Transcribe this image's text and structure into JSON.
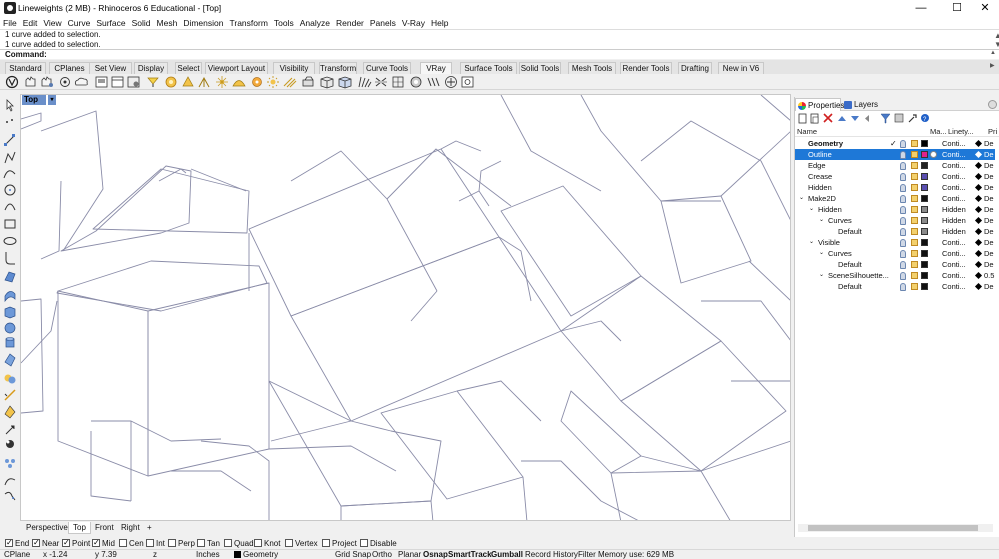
{
  "window": {
    "title": "Lineweights (2 MB) - Rhinoceros 6 Educational - [Top]",
    "minimize": "—",
    "maximize": "☐",
    "close": "✕"
  },
  "menu": [
    "File",
    "Edit",
    "View",
    "Curve",
    "Surface",
    "Solid",
    "Mesh",
    "Dimension",
    "Transform",
    "Tools",
    "Analyze",
    "Render",
    "Panels",
    "V-Ray",
    "Help"
  ],
  "command_history": [
    "1 curve added to selection.",
    "1 curve added to selection."
  ],
  "command": {
    "label": "Command:",
    "value": ""
  },
  "toolbar_tabs": [
    {
      "label": "Standard",
      "active": false
    },
    {
      "label": "CPlanes",
      "active": false
    },
    {
      "label": "Set View",
      "active": false
    },
    {
      "label": "Display",
      "active": false
    },
    {
      "label": "Select",
      "active": false
    },
    {
      "label": "Viewport Layout",
      "active": false
    },
    {
      "label": "Visibility",
      "active": false
    },
    {
      "label": "Transform",
      "active": false
    },
    {
      "label": "Curve Tools",
      "active": false
    },
    {
      "label": "VRay All",
      "active": true
    },
    {
      "label": "Surface Tools",
      "active": false
    },
    {
      "label": "Solid Tools",
      "active": false
    },
    {
      "label": "Mesh Tools",
      "active": false
    },
    {
      "label": "Render Tools",
      "active": false
    },
    {
      "label": "Drafting",
      "active": false
    },
    {
      "label": "New in V6",
      "active": false
    }
  ],
  "viewport": {
    "name": "Top",
    "caret": "▾"
  },
  "view_tabs": [
    {
      "label": "Perspective",
      "active": false
    },
    {
      "label": "Top",
      "active": true
    },
    {
      "label": "Front",
      "active": false
    },
    {
      "label": "Right",
      "active": false
    },
    {
      "label": "+",
      "active": false
    }
  ],
  "osnaps": [
    {
      "label": "End",
      "checked": true
    },
    {
      "label": "Near",
      "checked": true
    },
    {
      "label": "Point",
      "checked": true
    },
    {
      "label": "Mid",
      "checked": true
    },
    {
      "label": "Cen",
      "checked": false
    },
    {
      "label": "Int",
      "checked": false
    },
    {
      "label": "Perp",
      "checked": false
    },
    {
      "label": "Tan",
      "checked": false
    },
    {
      "label": "Quad",
      "checked": false
    },
    {
      "label": "Knot",
      "checked": false
    },
    {
      "label": "Vertex",
      "checked": false
    },
    {
      "label": "Project",
      "checked": false
    },
    {
      "label": "Disable",
      "checked": false
    }
  ],
  "status": {
    "cplane": "CPlane",
    "x": "x -1.24",
    "y": "y 7.39",
    "z": "z",
    "units": "Inches",
    "layer": "Geometry",
    "layer_color": "#000000",
    "toggles": [
      {
        "label": "Grid Snap",
        "bold": false
      },
      {
        "label": "Ortho",
        "bold": false
      },
      {
        "label": "Planar",
        "bold": false
      },
      {
        "label": "Osnap",
        "bold": true
      },
      {
        "label": "SmartTrack",
        "bold": true
      },
      {
        "label": "Gumball",
        "bold": true
      },
      {
        "label": "Record History",
        "bold": false
      },
      {
        "label": "Filter",
        "bold": false
      }
    ],
    "memory": "Memory use: 629 MB"
  },
  "panel": {
    "tabs": [
      {
        "label": "Properties",
        "active": true,
        "icon": "properties-icon"
      },
      {
        "label": "Layers",
        "active": false,
        "icon": "layers-icon"
      }
    ],
    "columns": {
      "name": "Name",
      "material": "Ma...",
      "linetype": "Linety...",
      "print": "Pri"
    },
    "layers": [
      {
        "name": "Geometry",
        "depth": 0,
        "expander": "",
        "bold": true,
        "current": true,
        "color": "#000000",
        "linetype": "Conti...",
        "print": "De",
        "selected": false
      },
      {
        "name": "Outline",
        "depth": 0,
        "expander": "",
        "bold": false,
        "current": false,
        "color": "#e0208a",
        "linetype": "Conti...",
        "print": "De",
        "selected": true
      },
      {
        "name": "Edge",
        "depth": 0,
        "expander": "",
        "bold": false,
        "current": false,
        "color": "#222222",
        "linetype": "Conti...",
        "print": "De",
        "selected": false
      },
      {
        "name": "Crease",
        "depth": 0,
        "expander": "",
        "bold": false,
        "current": false,
        "color": "#5a4fb0",
        "linetype": "Conti...",
        "print": "De",
        "selected": false
      },
      {
        "name": "Hidden",
        "depth": 0,
        "expander": "",
        "bold": false,
        "current": false,
        "color": "#5a4fb0",
        "linetype": "Conti...",
        "print": "De",
        "selected": false
      },
      {
        "name": "Make2D",
        "depth": 0,
        "expander": "⌄",
        "bold": false,
        "current": false,
        "color": "#111111",
        "linetype": "Conti...",
        "print": "De",
        "selected": false
      },
      {
        "name": "Hidden",
        "depth": 1,
        "expander": "⌄",
        "bold": false,
        "current": false,
        "color": "#8a8a8a",
        "linetype": "Hidden",
        "print": "De",
        "selected": false
      },
      {
        "name": "Curves",
        "depth": 2,
        "expander": "⌄",
        "bold": false,
        "current": false,
        "color": "#8a8a8a",
        "linetype": "Hidden",
        "print": "De",
        "selected": false
      },
      {
        "name": "Default",
        "depth": 3,
        "expander": "",
        "bold": false,
        "current": false,
        "color": "#8a8a8a",
        "linetype": "Hidden",
        "print": "De",
        "selected": false
      },
      {
        "name": "Visible",
        "depth": 1,
        "expander": "⌄",
        "bold": false,
        "current": false,
        "color": "#111111",
        "linetype": "Conti...",
        "print": "De",
        "selected": false
      },
      {
        "name": "Curves",
        "depth": 2,
        "expander": "⌄",
        "bold": false,
        "current": false,
        "color": "#111111",
        "linetype": "Conti...",
        "print": "De",
        "selected": false
      },
      {
        "name": "Default",
        "depth": 3,
        "expander": "",
        "bold": false,
        "current": false,
        "color": "#111111",
        "linetype": "Conti...",
        "print": "De",
        "selected": false
      },
      {
        "name": "SceneSilhouette...",
        "depth": 2,
        "expander": "⌄",
        "bold": false,
        "current": false,
        "color": "#111111",
        "linetype": "Conti...",
        "print": "0.5",
        "selected": false
      },
      {
        "name": "Default",
        "depth": 3,
        "expander": "",
        "bold": false,
        "current": false,
        "color": "#111111",
        "linetype": "Conti...",
        "print": "De",
        "selected": false
      }
    ]
  },
  "colors": {
    "selection": "#1e78d7",
    "viewport_label": "#6a8fc9",
    "wire": "#8a8ca8"
  }
}
